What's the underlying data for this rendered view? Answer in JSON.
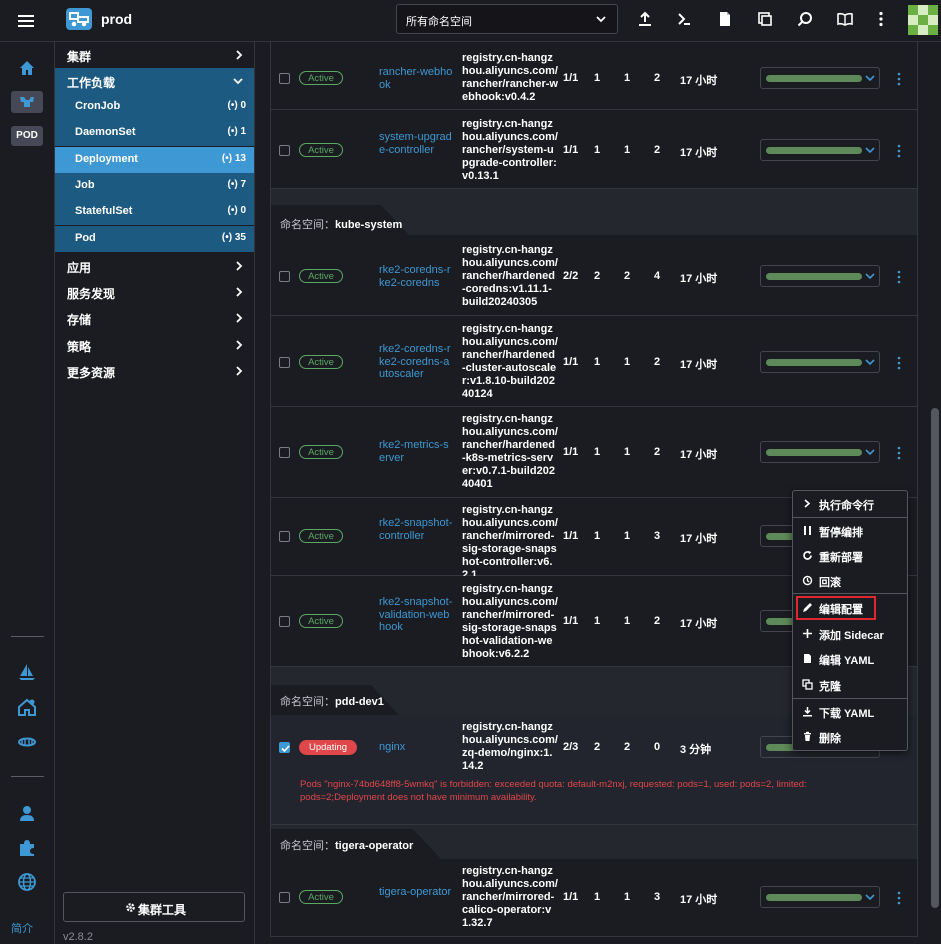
{
  "topbar": {
    "cluster_name": "prod",
    "namespace_select": "所有命名空间"
  },
  "rail": {
    "pod_label": "POD",
    "about_label": "简介"
  },
  "nav": {
    "groups_top": [
      {
        "label": "集群"
      }
    ],
    "workload": {
      "label": "工作负载",
      "items": [
        {
          "label": "CronJob",
          "count": "0"
        },
        {
          "label": "DaemonSet",
          "count": "1"
        },
        {
          "label": "Deployment",
          "count": "13"
        },
        {
          "label": "Job",
          "count": "7"
        },
        {
          "label": "StatefulSet",
          "count": "0"
        },
        {
          "label": "Pod",
          "count": "35"
        }
      ]
    },
    "groups_bottom": [
      {
        "label": "应用"
      },
      {
        "label": "服务发现"
      },
      {
        "label": "存储"
      },
      {
        "label": "策略"
      },
      {
        "label": "更多资源"
      }
    ],
    "tools_label": "集群工具",
    "version": "v2.8.2"
  },
  "table": {
    "namespace_prefix": "命名空间：",
    "namespaces": [
      "kube-system",
      "pdd-dev1",
      "tigera-operator"
    ],
    "rows": [
      {
        "state": "Active",
        "name": "rancher-webhook",
        "image": "registry.cn-hangzhou.aliyuncs.com/rancher/rancher-webhook:v0.4.2",
        "ready": "1/1",
        "up_to_date": "1",
        "available": "1",
        "restarts": "2",
        "age": "17 小时"
      },
      {
        "state": "Active",
        "name": "system-upgrade-controller",
        "image": "registry.cn-hangzhou.aliyuncs.com/rancher/system-upgrade-controller:v0.13.1",
        "ready": "1/1",
        "up_to_date": "1",
        "available": "1",
        "restarts": "2",
        "age": "17 小时"
      },
      {
        "state": "Active",
        "name": "rke2-coredns-rke2-coredns",
        "image": "registry.cn-hangzhou.aliyuncs.com/rancher/hardened-coredns:v1.11.1-build20240305",
        "ready": "2/2",
        "up_to_date": "2",
        "available": "2",
        "restarts": "4",
        "age": "17 小时"
      },
      {
        "state": "Active",
        "name": "rke2-coredns-rke2-coredns-autoscaler",
        "image": "registry.cn-hangzhou.aliyuncs.com/rancher/hardened-cluster-autoscaler:v1.8.10-build20240124",
        "ready": "1/1",
        "up_to_date": "1",
        "available": "1",
        "restarts": "2",
        "age": "17 小时"
      },
      {
        "state": "Active",
        "name": "rke2-metrics-server",
        "image": "registry.cn-hangzhou.aliyuncs.com/rancher/hardened-k8s-metrics-server:v0.7.1-build20240401",
        "ready": "1/1",
        "up_to_date": "1",
        "available": "1",
        "restarts": "2",
        "age": "17 小时"
      },
      {
        "state": "Active",
        "name": "rke2-snapshot-controller",
        "image": "registry.cn-hangzhou.aliyuncs.com/rancher/mirrored-sig-storage-snapshot-controller:v6.2.1",
        "ready": "1/1",
        "up_to_date": "1",
        "available": "1",
        "restarts": "3",
        "age": "17 小时"
      },
      {
        "state": "Active",
        "name": "rke2-snapshot-validation-webhook",
        "image": "registry.cn-hangzhou.aliyuncs.com/rancher/mirrored-sig-storage-snapshot-validation-webhook:v6.2.2",
        "ready": "1/1",
        "up_to_date": "1",
        "available": "1",
        "restarts": "2",
        "age": "17 小时"
      },
      {
        "state": "Updating",
        "name": "nginx",
        "image": "registry.cn-hangzhou.aliyuncs.com/zq-demo/nginx:1.14.2",
        "ready": "2/3",
        "up_to_date": "2",
        "available": "2",
        "restarts": "0",
        "age": "3 分钟",
        "error": "Pods \"nginx-74bd648ff8-5wmkq\" is forbidden: exceeded quota: default-m2nxj, requested: pods=1, used: pods=2, limited: pods=2;Deployment does not have minimum availability."
      },
      {
        "state": "Active",
        "name": "tigera-operator",
        "image": "registry.cn-hangzhou.aliyuncs.com/rancher/mirrored-calico-operator:v1.32.7",
        "ready": "1/1",
        "up_to_date": "1",
        "available": "1",
        "restarts": "3",
        "age": "17 小时"
      }
    ]
  },
  "context_menu": {
    "items": [
      "执行命令行",
      "暂停编排",
      "重新部署",
      "回滚",
      "编辑配置",
      "添加 Sidecar",
      "编辑 YAML",
      "克隆",
      "下载 YAML",
      "删除"
    ]
  },
  "colors": {
    "accent": "#3d98d3",
    "active_green": "#5aa864",
    "danger": "#e0474b",
    "nav_open": "#1d5a82"
  }
}
